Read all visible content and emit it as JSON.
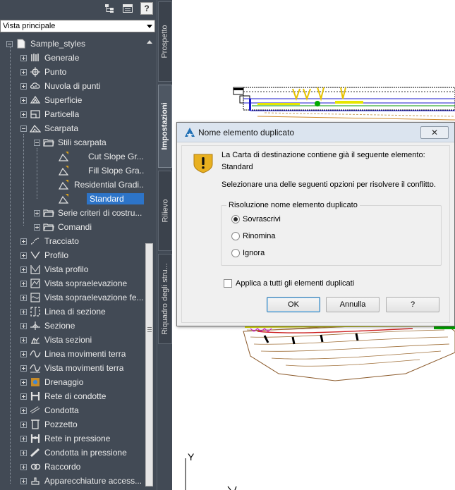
{
  "toolbar": {
    "help_label": "?"
  },
  "view_selector": {
    "value": "Vista principale"
  },
  "tree": {
    "root": "Sample_styles",
    "items": [
      {
        "label": "Generale",
        "icon": "general-icon"
      },
      {
        "label": "Punto",
        "icon": "point-icon"
      },
      {
        "label": "Nuvola di punti",
        "icon": "point-cloud-icon"
      },
      {
        "label": "Superficie",
        "icon": "surface-icon"
      },
      {
        "label": "Particella",
        "icon": "parcel-icon"
      },
      {
        "label": "Scarpata",
        "icon": "grading-icon"
      },
      {
        "label": "Stili scarpata",
        "icon": "folder-icon"
      },
      {
        "label": "Cut Slope Gr...",
        "icon": "style-icon"
      },
      {
        "label": "Fill Slope Gra...",
        "icon": "style-icon"
      },
      {
        "label": "Residential Gradi...",
        "icon": "style-icon"
      },
      {
        "label": "Standard",
        "icon": "style-icon"
      },
      {
        "label": "Serie criteri di costru...",
        "icon": "folder-icon"
      },
      {
        "label": "Comandi",
        "icon": "folder-icon"
      },
      {
        "label": "Tracciato",
        "icon": "alignment-icon"
      },
      {
        "label": "Profilo",
        "icon": "profile-icon"
      },
      {
        "label": "Vista profilo",
        "icon": "profile-view-icon"
      },
      {
        "label": "Vista sopraelevazione",
        "icon": "superelevation-view-icon"
      },
      {
        "label": "Vista sopraelevazione fe...",
        "icon": "superelevation-view-icon"
      },
      {
        "label": "Linea di sezione",
        "icon": "sample-line-icon"
      },
      {
        "label": "Sezione",
        "icon": "section-icon"
      },
      {
        "label": "Vista sezioni",
        "icon": "section-view-icon"
      },
      {
        "label": "Linea movimenti terra",
        "icon": "mass-haul-line-icon"
      },
      {
        "label": "Vista movimenti terra",
        "icon": "mass-haul-view-icon"
      },
      {
        "label": "Drenaggio",
        "icon": "catchment-icon"
      },
      {
        "label": "Rete di condotte",
        "icon": "pipe-network-icon"
      },
      {
        "label": "Condotta",
        "icon": "pipe-icon"
      },
      {
        "label": "Pozzetto",
        "icon": "structure-icon"
      },
      {
        "label": "Rete in pressione",
        "icon": "pressure-network-icon"
      },
      {
        "label": "Condotta in pressione",
        "icon": "pressure-pipe-icon"
      },
      {
        "label": "Raccordo",
        "icon": "fitting-icon"
      },
      {
        "label": "Apparecchiature access...",
        "icon": "appurtenance-icon"
      }
    ]
  },
  "vertical_tabs": [
    {
      "label": "Prospetto"
    },
    {
      "label": "Impostazioni",
      "active": true
    },
    {
      "label": "Rilievo"
    },
    {
      "label": "Riquadro degli stru..."
    }
  ],
  "dialog": {
    "title": "Nome elemento duplicato",
    "close_label": "✕",
    "message_line1": "La Carta di destinazione contiene già il seguente elemento:",
    "message_line2": "Standard",
    "message_line3": "Selezionare una delle seguenti opzioni per risolvere il conflitto.",
    "group_title": "Risoluzione nome elemento duplicato",
    "options": [
      {
        "label": "Sovrascrivi",
        "selected": true
      },
      {
        "label": "Rinomina",
        "selected": false
      },
      {
        "label": "Ignora",
        "selected": false
      }
    ],
    "apply_all_label": "Applica a tutti gli elementi duplicati",
    "apply_all_checked": false,
    "ok_label": "OK",
    "cancel_label": "Annulla",
    "help_label": "?"
  },
  "drawing": {
    "axis_label": "Y"
  },
  "colors": {
    "panel_bg": "#424a55",
    "selection": "#2d74c8",
    "dialog_bg": "#f0f0f0",
    "title_bar": "#dbe4ef"
  }
}
